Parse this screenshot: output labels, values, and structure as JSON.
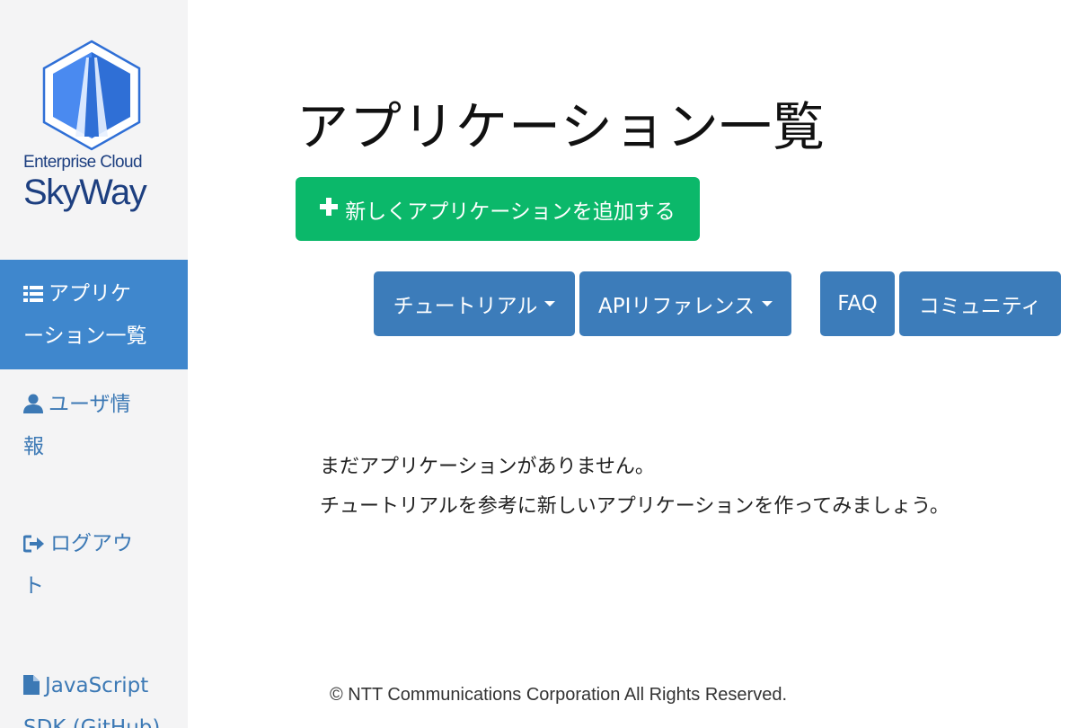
{
  "sidebar": {
    "logo": {
      "line1": "Enterprise Cloud",
      "line2": "SkyWay"
    },
    "items": [
      {
        "label_l1": "アプリケ",
        "label_l2": "ーション一覧",
        "icon": "list-icon",
        "active": true
      },
      {
        "label_l1": "ユーザ情",
        "label_l2": "報",
        "icon": "user-icon",
        "active": false
      },
      {
        "label_l1": "ログアウ",
        "label_l2": "ト",
        "icon": "logout-icon",
        "active": false
      },
      {
        "label_l1": "JavaScript",
        "label_l2": "SDK (GitHub)",
        "icon": "file-icon",
        "active": false
      }
    ]
  },
  "main": {
    "title": "アプリケーション一覧",
    "add_button": "新しくアプリケーションを追加する",
    "nav_buttons": [
      {
        "label": "チュートリアル",
        "dropdown": true
      },
      {
        "label": "APIリファレンス",
        "dropdown": true
      },
      {
        "label": "FAQ",
        "dropdown": false
      },
      {
        "label": "コミュニティ",
        "dropdown": false
      }
    ],
    "empty_message": [
      "まだアプリケーションがありません。",
      "チュートリアルを参考に新しいアプリケーションを作ってみましょう。"
    ]
  },
  "footer": {
    "copyright": "© NTT Communications Corporation All Rights Reserved."
  },
  "colors": {
    "sidebar_bg": "#f4f4f5",
    "active_nav": "#3f87cd",
    "nav_text": "#3c79b5",
    "add_button": "#0bb86a",
    "blue_button": "#3c7cba",
    "brand": "#1d3f80"
  }
}
